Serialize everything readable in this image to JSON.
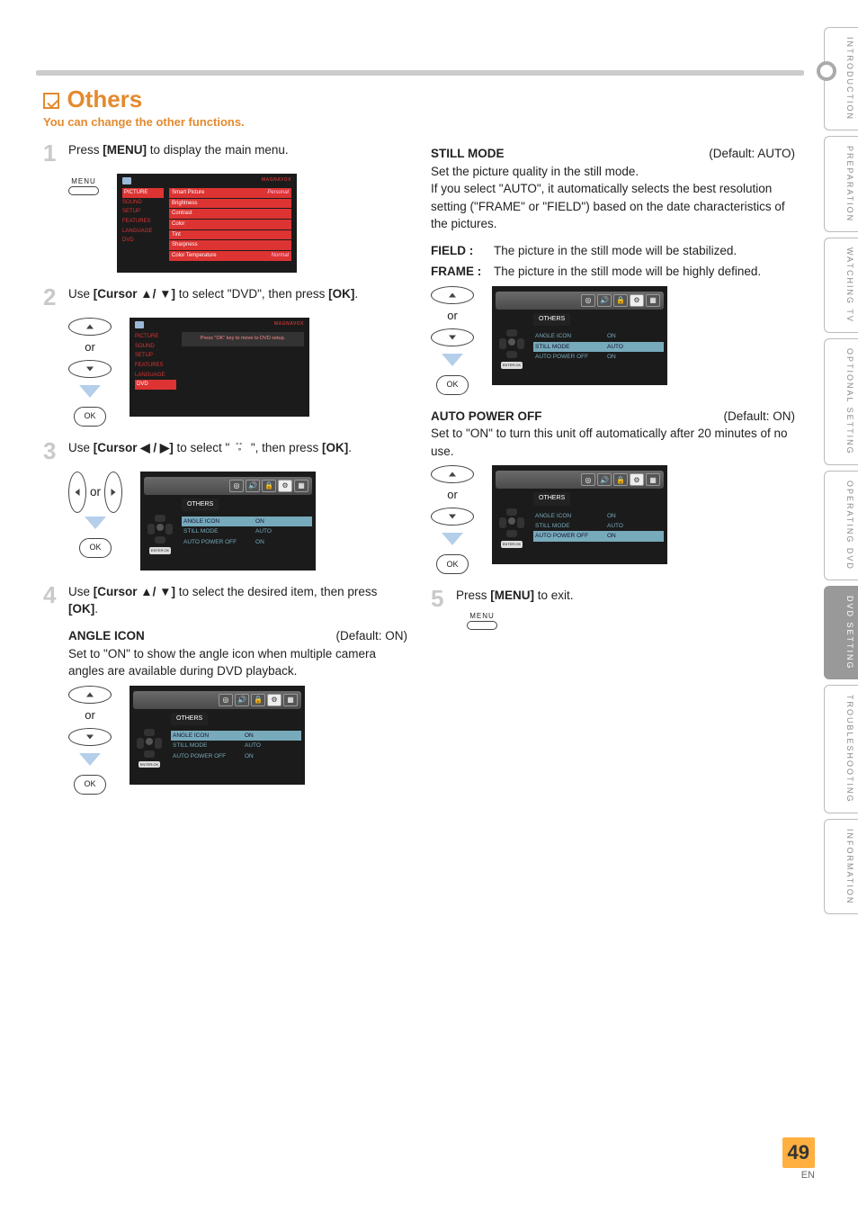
{
  "page_number": "49",
  "page_lang": "EN",
  "side_tabs": {
    "introduction": "INTRODUCTION",
    "preparation": "PREPARATION",
    "watching_tv": "WATCHING TV",
    "optional_setting": "OPTIONAL SETTING",
    "operating_dvd": "OPERATING DVD",
    "dvd_setting": "DVD SETTING",
    "troubleshooting": "TROUBLESHOOTING",
    "information": "INFORMATION"
  },
  "section": {
    "title": "Others",
    "subtitle": "You can change the other functions."
  },
  "steps": {
    "s1": {
      "num": "1",
      "pre": "Press ",
      "btn": "[MENU]",
      "post": " to display the main menu."
    },
    "s2": {
      "num": "2",
      "pre": "Use ",
      "btn": "[Cursor ▲/ ▼]",
      "mid": " to select \"DVD\", then press ",
      "btn2": "[OK]",
      "post": "."
    },
    "s3": {
      "num": "3",
      "pre": "Use ",
      "btn": "[Cursor ◀ / ▶]",
      "mid": " to select \" ",
      "icon": "⚙",
      "mid2": " \", then press ",
      "btn2": "[OK]",
      "post": "."
    },
    "s4": {
      "num": "4",
      "pre": "Use ",
      "btn": "[Cursor ▲/ ▼]",
      "mid": " to select the desired item, then press ",
      "btn2": "[OK]",
      "post": "."
    },
    "s5": {
      "num": "5",
      "pre": "Press ",
      "btn": "[MENU]",
      "post": " to exit."
    }
  },
  "angle_icon": {
    "title": "ANGLE ICON",
    "default": "(Default: ON)",
    "desc": "Set to \"ON\" to show the angle icon when multiple camera angles are available during DVD playback."
  },
  "still_mode": {
    "title": "STILL MODE",
    "default": "(Default: AUTO)",
    "desc1": "Set the picture quality in the still mode.",
    "desc2": "If you select \"AUTO\", it automatically selects the best resolution setting (\"FRAME\" or \"FIELD\") based on the date characteristics of the pictures.",
    "field_k": "FIELD :",
    "field_v": "The picture in the still mode will be stabilized.",
    "frame_k": "FRAME :",
    "frame_v": "The picture in the still mode will be highly defined."
  },
  "auto_power_off": {
    "title": "AUTO POWER OFF",
    "default": "(Default: ON)",
    "desc": "Set to \"ON\" to turn this unit off automatically after 20 minutes of no use."
  },
  "menus": {
    "brand": "MAGNAVOX",
    "left": {
      "picture": "PICTURE",
      "sound": "SOUND",
      "setup": "SETUP",
      "features": "FEATURES",
      "language": "LANGUAGE",
      "dvd": "DVD"
    },
    "right_main": {
      "smart_picture": "Smart Picture",
      "smart_picture_v": "Personal",
      "brightness": "Brightness",
      "contrast": "Contrast",
      "color": "Color",
      "tint": "Tint",
      "sharpness": "Sharpness",
      "color_temp": "Color Temperature",
      "color_temp_v": "Normal"
    },
    "dvd_note": "Press \"OK\" key to move to DVD setup.",
    "others_label": "OTHERS",
    "others_rows": {
      "angle_icon_k": "ANGLE ICON",
      "angle_icon_v": "ON",
      "still_mode_k": "STILL MODE",
      "still_mode_v": "AUTO",
      "auto_power_k": "AUTO POWER OFF",
      "auto_power_v": "ON"
    },
    "enter_ok": "ENTER:OK"
  },
  "labels": {
    "or": "or",
    "ok": "OK",
    "menu_small": "MENU"
  }
}
